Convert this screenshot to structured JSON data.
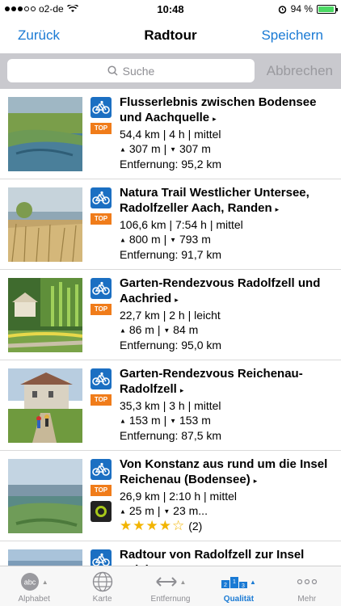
{
  "status_bar": {
    "carrier": "o2-de",
    "time": "10:48",
    "battery": "94 %",
    "battery_level": 0.94
  },
  "nav": {
    "back_label": "Zurück",
    "title": "Radtour",
    "save_label": "Speichern"
  },
  "search": {
    "placeholder": "Suche",
    "cancel_label": "Abbrechen"
  },
  "tours": [
    {
      "title": "Flusserlebnis zwischen Bodensee und Aachquelle",
      "badge": "TOP",
      "stats": "54,4 km | 4 h | mittel",
      "ascent": "307 m",
      "descent": "307 m",
      "distance": "Entfernung: 95,2 km"
    },
    {
      "title": "Natura Trail Westlicher Untersee, Radolfzeller Aach, Randen",
      "badge": "TOP",
      "stats": "106,6 km | 7:54 h | mittel",
      "ascent": "800 m",
      "descent": "793 m",
      "distance": "Entfernung: 91,7 km"
    },
    {
      "title": "Garten-Rendezvous Radolfzell und Aachried",
      "badge": "TOP",
      "stats": "22,7 km | 2 h | leicht",
      "ascent": "86 m",
      "descent": "84 m",
      "distance": "Entfernung: 95,0 km"
    },
    {
      "title": "Garten-Rendezvous Reichenau-Radolfzell",
      "badge": "TOP",
      "stats": "35,3 km | 3 h | mittel",
      "ascent": "153 m",
      "descent": "153 m",
      "distance": "Entfernung: 87,5 km"
    },
    {
      "title": "Von Konstanz aus rund um die Insel Reichenau (Bodensee)",
      "badge": "TOP",
      "stats": "26,9 km | 2:10 h | mittel",
      "ascent": "25 m",
      "descent": "23 m...",
      "rating": 4,
      "rating_max": 5,
      "reviews": "(2)"
    },
    {
      "title": "Radtour von Radolfzell zur Insel Reichenau"
    }
  ],
  "tab_bar": {
    "items": [
      {
        "label": "Alphabet",
        "icon": "abc-icon"
      },
      {
        "label": "Karte",
        "icon": "globe-icon"
      },
      {
        "label": "Entfernung",
        "icon": "distance-arrows-icon"
      },
      {
        "label": "Qualität",
        "icon": "podium-icon",
        "active": true
      },
      {
        "label": "Mehr",
        "icon": "more-dots-icon"
      }
    ],
    "podium_labels": [
      "2",
      "1",
      "3"
    ]
  },
  "colors": {
    "accent": "#1a7ad4",
    "badge": "#f07c1a",
    "bike_icon_bg": "#1b6fc2",
    "stars": "#f2b400"
  }
}
